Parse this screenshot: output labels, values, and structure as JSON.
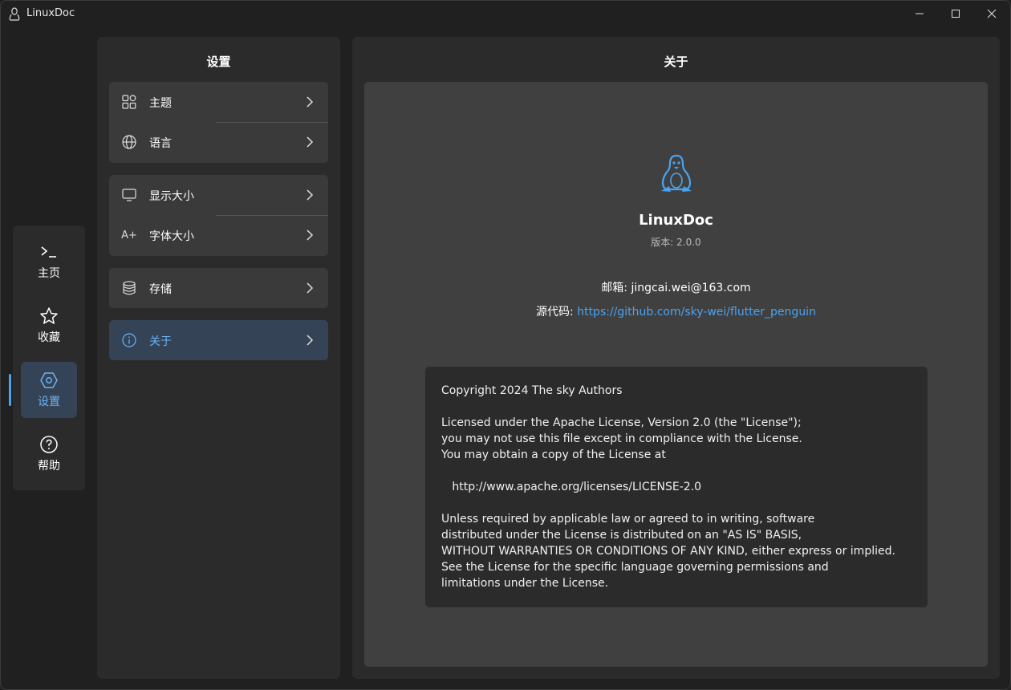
{
  "window": {
    "title": "LinuxDoc"
  },
  "nav": {
    "items": [
      {
        "label": "主页",
        "icon": "terminal-icon"
      },
      {
        "label": "收藏",
        "icon": "star-icon"
      },
      {
        "label": "设置",
        "icon": "settings-hex-icon",
        "active": true
      },
      {
        "label": "帮助",
        "icon": "help-circle-icon"
      }
    ]
  },
  "settings": {
    "title": "设置",
    "groups": [
      {
        "items": [
          {
            "label": "主题",
            "icon": "theme-grid-icon"
          },
          {
            "label": "语言",
            "icon": "globe-icon"
          }
        ]
      },
      {
        "items": [
          {
            "label": "显示大小",
            "icon": "monitor-icon"
          },
          {
            "label": "字体大小",
            "icon": "font-size-icon",
            "icon_text": "A+"
          }
        ]
      },
      {
        "items": [
          {
            "label": "存储",
            "icon": "database-icon"
          }
        ]
      },
      {
        "items": [
          {
            "label": "关于",
            "icon": "info-icon",
            "active": true
          }
        ]
      }
    ]
  },
  "about": {
    "title": "关于",
    "app_name": "LinuxDoc",
    "version": "版本: 2.0.0",
    "email": "邮箱: jingcai.wei@163.com",
    "source_label": "源代码: ",
    "source_url": "https://github.com/sky-wei/flutter_penguin",
    "license_lines": [
      "Copyright 2024 The sky Authors",
      "",
      "Licensed under the Apache License, Version 2.0 (the \"License\");",
      "you may not use this file except in compliance with the License.",
      "You may obtain a copy of the License at",
      "",
      "   http://www.apache.org/licenses/LICENSE-2.0",
      "",
      "Unless required by applicable law or agreed to in writing, software",
      "distributed under the License is distributed on an \"AS IS\" BASIS,",
      "WITHOUT WARRANTIES OR CONDITIONS OF ANY KIND, either express or implied.",
      "See the License for the specific language governing permissions and",
      "limitations under the License."
    ]
  },
  "colors": {
    "accent": "#4aa3f0",
    "active_bg": "#344356",
    "card_bg": "#404040",
    "panel_bg": "#2b2b2b"
  }
}
